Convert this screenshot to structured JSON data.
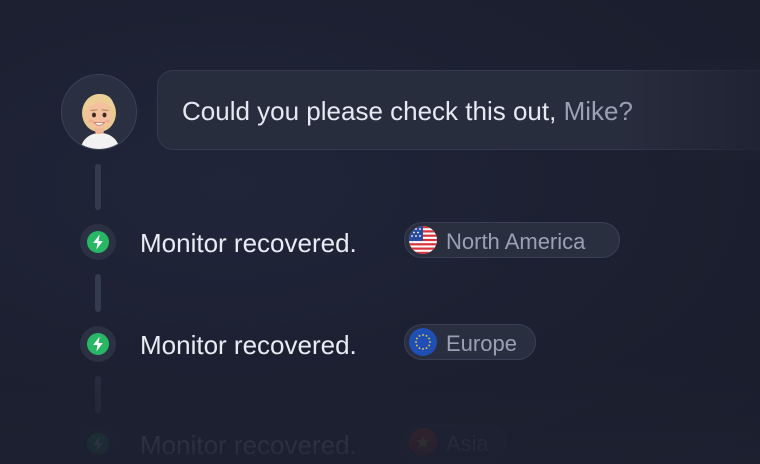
{
  "comment": {
    "text": "Could you please check this out,",
    "mention": "Mike?"
  },
  "events": [
    {
      "text": "Monitor recovered.",
      "region": "North America",
      "icon": "lightning-bolt-icon",
      "flag": "us-flag-icon"
    },
    {
      "text": "Monitor recovered.",
      "region": "Europe",
      "icon": "lightning-bolt-icon",
      "flag": "eu-flag-icon"
    },
    {
      "text": "Monitor recovered.",
      "region": "Asia",
      "icon": "lightning-bolt-icon",
      "flag": "vietnam-flag-icon"
    }
  ],
  "colors": {
    "background": "#1c2030",
    "status_up": "#28b765",
    "mention": "#9aa1b3"
  }
}
